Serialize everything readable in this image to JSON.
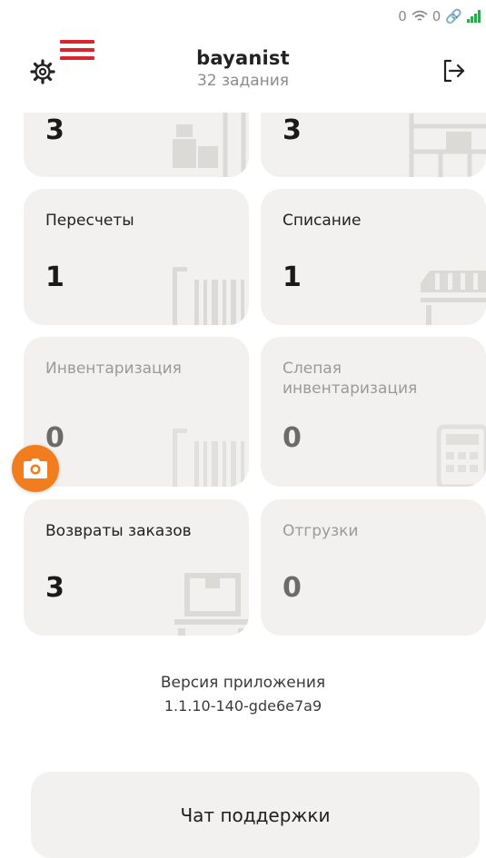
{
  "status_bar": {
    "left_count": "0",
    "right_count": "0"
  },
  "header": {
    "title": "bayanist",
    "subtitle": "32 задания",
    "settings_icon": "gear-icon",
    "menu_icon": "hamburger-menu-icon",
    "logout_icon": "logout-arrow-icon",
    "menu_color": "#d9262d"
  },
  "cards": [
    {
      "label": "",
      "count": "3",
      "enabled": true,
      "icon": "boxes-shelf-icon"
    },
    {
      "label": "",
      "count": "3",
      "enabled": true,
      "icon": "shelving-icon"
    },
    {
      "label": "Пересчеты",
      "count": "1",
      "enabled": true,
      "icon": "barcode-icon"
    },
    {
      "label": "Списание",
      "count": "1",
      "enabled": true,
      "icon": "cart-icon"
    },
    {
      "label": "Инвентаризация",
      "count": "0",
      "enabled": false,
      "icon": "barcode-icon"
    },
    {
      "label": "Слепая инвентаризация",
      "count": "0",
      "enabled": false,
      "icon": "calculator-icon"
    },
    {
      "label": "Возвраты заказов",
      "count": "3",
      "enabled": true,
      "icon": "package-cart-icon"
    },
    {
      "label": "Отгрузки",
      "count": "0",
      "enabled": false,
      "icon": ""
    }
  ],
  "camera_button": {
    "icon": "camera-icon",
    "color": "#f27d1e"
  },
  "version": {
    "label": "Версия приложения",
    "value": "1.1.10-140-gde6e7a9"
  },
  "chat_button": {
    "label": "Чат поддержки"
  }
}
